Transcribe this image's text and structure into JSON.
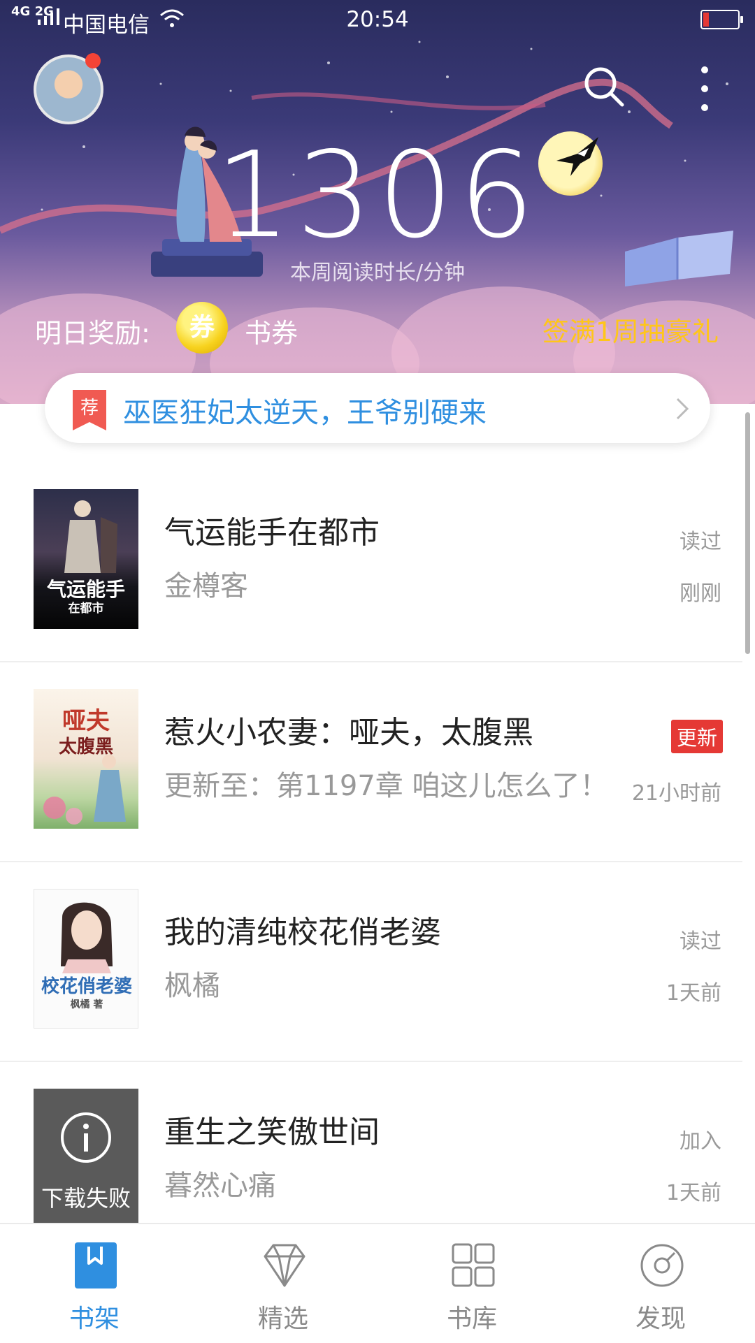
{
  "status_bar": {
    "network": "4G 2G",
    "carrier": "中国电信",
    "time": "20:54"
  },
  "header": {
    "reading_minutes": "1306",
    "reading_label": "本周阅读时长/分钟",
    "reward_label": "明日奖励:",
    "coin_label": "券",
    "reward_item": "书券",
    "signin_promo": "签满1周抽豪礼"
  },
  "recommendation": {
    "tag": "荐",
    "text": "巫医狂妃太逆天，王爷别硬来"
  },
  "books": [
    {
      "title": "气运能手在都市",
      "subtitle": "金樽客",
      "status": "读过",
      "time": "刚刚",
      "cover_text": "气运能手",
      "cover_sub": "在都市"
    },
    {
      "title": "惹火小农妻：哑夫，太腹黑",
      "subtitle": "更新至：第1197章 咱这儿怎么了！",
      "status": "更新",
      "time": "21小时前",
      "cover_text": "哑夫",
      "cover_sub": "太腹黑"
    },
    {
      "title": "我的清纯校花俏老婆",
      "subtitle": "枫橘",
      "status": "读过",
      "time": "1天前",
      "cover_text": "校花俏老婆",
      "cover_sub": "枫橘 著"
    },
    {
      "title": "重生之笑傲世间",
      "subtitle": "暮然心痛",
      "status": "加入",
      "time": "1天前",
      "cover_text": "下载失败",
      "cover_sub": ""
    }
  ],
  "nav": [
    {
      "label": "书架",
      "icon": "bookshelf-icon",
      "active": true
    },
    {
      "label": "精选",
      "icon": "diamond-icon",
      "active": false
    },
    {
      "label": "书库",
      "icon": "grid-icon",
      "active": false
    },
    {
      "label": "发现",
      "icon": "compass-icon",
      "active": false
    }
  ],
  "colors": {
    "accent": "#2f8fe0",
    "promo": "#ffc61a",
    "badge": "#e53935"
  }
}
